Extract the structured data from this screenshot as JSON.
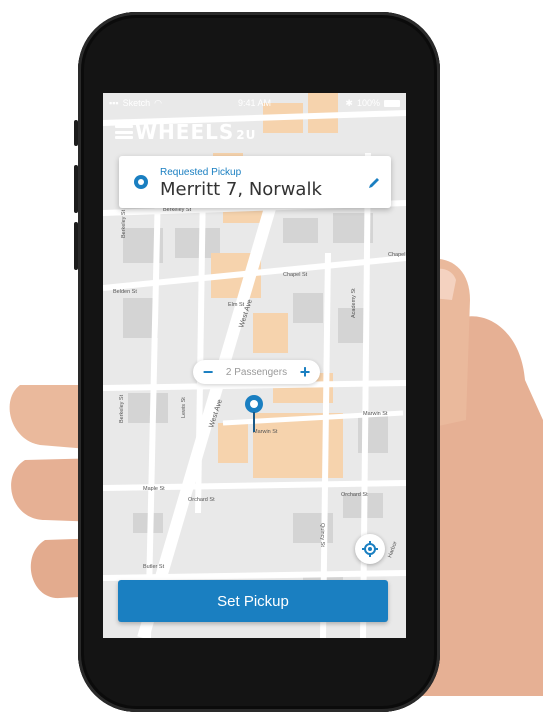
{
  "status_bar": {
    "carrier": "Sketch",
    "time": "9:41 AM",
    "battery": "100%"
  },
  "app": {
    "logo_text": "WHEELS",
    "logo_suffix": "2U"
  },
  "pickup": {
    "label": "Requested Pickup",
    "address": "Merritt 7, Norwalk"
  },
  "passengers": {
    "minus": "−",
    "text": "2 Passengers",
    "plus": "+"
  },
  "streets": {
    "berkeley": "Berkeley St",
    "berkeley_v": "Berkeley St",
    "berkeley_v2": "Berkeley St",
    "belden": "Belden St",
    "elm": "Elm St",
    "chapel": "Chapel St",
    "academy": "Academy St",
    "west_ave": "West Ave",
    "west_ave2": "West Ave",
    "marwin": "Marwin St",
    "marwin2": "Marwin St",
    "maple": "Maple St",
    "orchard": "Orchard St",
    "orchard2": "Orchard St",
    "butler": "Butler St",
    "lewis": "Lewis St",
    "quincy": "Quincy St",
    "harbor": "Harbor",
    "chapel_e": "Chapel"
  },
  "actions": {
    "set_pickup": "Set Pickup"
  },
  "colors": {
    "accent": "#1a7fc1",
    "building_orange": "#f6d3ad"
  },
  "icons": {
    "menu": "hamburger-menu-icon",
    "pin": "location-pin-icon",
    "edit": "pencil-icon",
    "locate": "crosshair-icon"
  }
}
